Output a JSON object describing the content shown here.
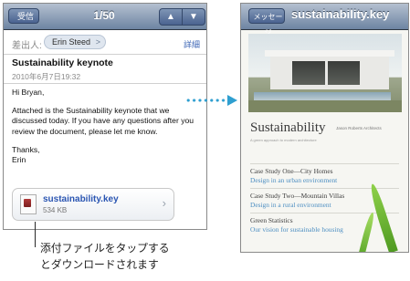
{
  "mail": {
    "nav": {
      "back_label": "受信",
      "counter": "1/50",
      "up_icon": "▲",
      "down_icon": "▼"
    },
    "from_label": "差出人:",
    "from_name": "Erin Steed",
    "details_label": "詳細",
    "subject": "Sustainability keynote",
    "date": "2010年6月7日19:32",
    "body": [
      "Hi Bryan,",
      "Attached is the Sustainability keynote that we discussed today. If you have any questions after you review the document, please let me know.",
      "Thanks,\nErin"
    ],
    "attachment": {
      "name": "sustainability.key",
      "size": "534 KB"
    }
  },
  "caption": {
    "line1": "添付ファイルをタップする",
    "line2": "とダウンロードされます"
  },
  "viewer": {
    "back_label": "メッセージ",
    "title": "sustainability.key",
    "heading": "Sustainability",
    "heading_small": "Jason Roberts Architects",
    "subtitle": "A green approach to modern architecture",
    "case_studies": [
      {
        "title": "Case Study One—City Homes",
        "subtitle": "Design in an urban environment"
      },
      {
        "title": "Case Study Two—Mountain Villas",
        "subtitle": "Design in a rural environment"
      },
      {
        "title": "Green Statistics",
        "subtitle": "Our vision for sustainable housing"
      }
    ]
  },
  "colors": {
    "nav": "#6d84a2",
    "link": "#2a55b2",
    "arrow": "#2f9fd0",
    "case_sub": "#4e8fc2"
  }
}
